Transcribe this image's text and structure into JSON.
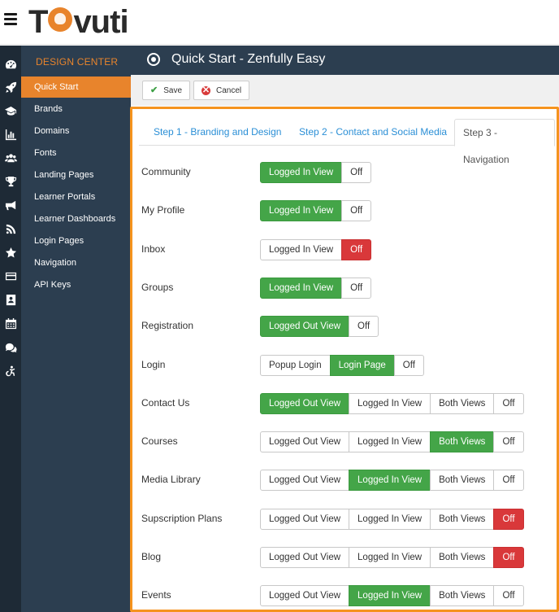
{
  "brand": {
    "logo_text_left": "T",
    "logo_text_right": "vuti",
    "accent": "#e8842c"
  },
  "sidebar": {
    "header": "DESIGN CENTER",
    "items": [
      {
        "label": "Quick Start",
        "active": true
      },
      {
        "label": "Brands"
      },
      {
        "label": "Domains"
      },
      {
        "label": "Fonts"
      },
      {
        "label": "Landing Pages"
      },
      {
        "label": "Learner Portals"
      },
      {
        "label": "Learner Dashboards"
      },
      {
        "label": "Login Pages"
      },
      {
        "label": "Navigation"
      },
      {
        "label": "API Keys"
      }
    ]
  },
  "rail_icons": [
    "dashboard-icon",
    "rocket-icon",
    "graduation-cap-icon",
    "bar-chart-icon",
    "users-icon",
    "trophy-icon",
    "bullhorn-icon",
    "feed-icon",
    "star-icon",
    "credit-card-icon",
    "contact-card-icon",
    "calendar-icon",
    "comments-icon",
    "accessibility-icon"
  ],
  "page": {
    "title": "Quick Start - Zenfully Easy"
  },
  "toolbar": {
    "save_label": "Save",
    "cancel_label": "Cancel"
  },
  "tabs": [
    {
      "label": "Step 1 - Branding and Design"
    },
    {
      "label": "Step 2 - Contact and Social Media"
    },
    {
      "label": "Step 3 - Navigation",
      "active": true
    }
  ],
  "settings": [
    {
      "label": "Community",
      "options": [
        {
          "label": "Logged In View",
          "state": "green"
        },
        {
          "label": "Off"
        }
      ]
    },
    {
      "label": "My Profile",
      "options": [
        {
          "label": "Logged In View",
          "state": "green"
        },
        {
          "label": "Off"
        }
      ]
    },
    {
      "label": "Inbox",
      "options": [
        {
          "label": "Logged In View"
        },
        {
          "label": "Off",
          "state": "red"
        }
      ]
    },
    {
      "label": "Groups",
      "options": [
        {
          "label": "Logged In View",
          "state": "green"
        },
        {
          "label": "Off"
        }
      ]
    },
    {
      "label": "Registration",
      "options": [
        {
          "label": "Logged Out View",
          "state": "green"
        },
        {
          "label": "Off"
        }
      ]
    },
    {
      "label": "Login",
      "options": [
        {
          "label": "Popup Login"
        },
        {
          "label": "Login Page",
          "state": "green"
        },
        {
          "label": "Off"
        }
      ]
    },
    {
      "label": "Contact Us",
      "options": [
        {
          "label": "Logged Out View",
          "state": "green"
        },
        {
          "label": "Logged In View"
        },
        {
          "label": "Both Views"
        },
        {
          "label": "Off"
        }
      ]
    },
    {
      "label": "Courses",
      "options": [
        {
          "label": "Logged Out View"
        },
        {
          "label": "Logged In View"
        },
        {
          "label": "Both Views",
          "state": "green"
        },
        {
          "label": "Off"
        }
      ]
    },
    {
      "label": "Media Library",
      "options": [
        {
          "label": "Logged Out View"
        },
        {
          "label": "Logged In View",
          "state": "green"
        },
        {
          "label": "Both Views"
        },
        {
          "label": "Off"
        }
      ]
    },
    {
      "label": "Supscription Plans",
      "options": [
        {
          "label": "Logged Out View"
        },
        {
          "label": "Logged In View"
        },
        {
          "label": "Both Views"
        },
        {
          "label": "Off",
          "state": "red"
        }
      ]
    },
    {
      "label": "Blog",
      "options": [
        {
          "label": "Logged Out View"
        },
        {
          "label": "Logged In View"
        },
        {
          "label": "Both Views"
        },
        {
          "label": "Off",
          "state": "red"
        }
      ]
    },
    {
      "label": "Events",
      "options": [
        {
          "label": "Logged Out View"
        },
        {
          "label": "Logged In View",
          "state": "green"
        },
        {
          "label": "Both Views"
        },
        {
          "label": "Off"
        }
      ]
    }
  ]
}
